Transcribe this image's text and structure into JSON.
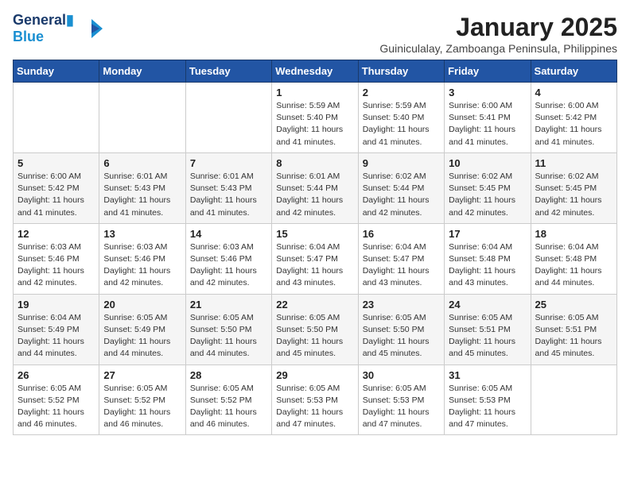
{
  "logo": {
    "line1": "General",
    "line2": "Blue"
  },
  "title": "January 2025",
  "subtitle": "Guiniculalay, Zamboanga Peninsula, Philippines",
  "days_of_week": [
    "Sunday",
    "Monday",
    "Tuesday",
    "Wednesday",
    "Thursday",
    "Friday",
    "Saturday"
  ],
  "weeks": [
    [
      {
        "day": "",
        "info": ""
      },
      {
        "day": "",
        "info": ""
      },
      {
        "day": "",
        "info": ""
      },
      {
        "day": "1",
        "info": "Sunrise: 5:59 AM\nSunset: 5:40 PM\nDaylight: 11 hours\nand 41 minutes."
      },
      {
        "day": "2",
        "info": "Sunrise: 5:59 AM\nSunset: 5:40 PM\nDaylight: 11 hours\nand 41 minutes."
      },
      {
        "day": "3",
        "info": "Sunrise: 6:00 AM\nSunset: 5:41 PM\nDaylight: 11 hours\nand 41 minutes."
      },
      {
        "day": "4",
        "info": "Sunrise: 6:00 AM\nSunset: 5:42 PM\nDaylight: 11 hours\nand 41 minutes."
      }
    ],
    [
      {
        "day": "5",
        "info": "Sunrise: 6:00 AM\nSunset: 5:42 PM\nDaylight: 11 hours\nand 41 minutes."
      },
      {
        "day": "6",
        "info": "Sunrise: 6:01 AM\nSunset: 5:43 PM\nDaylight: 11 hours\nand 41 minutes."
      },
      {
        "day": "7",
        "info": "Sunrise: 6:01 AM\nSunset: 5:43 PM\nDaylight: 11 hours\nand 41 minutes."
      },
      {
        "day": "8",
        "info": "Sunrise: 6:01 AM\nSunset: 5:44 PM\nDaylight: 11 hours\nand 42 minutes."
      },
      {
        "day": "9",
        "info": "Sunrise: 6:02 AM\nSunset: 5:44 PM\nDaylight: 11 hours\nand 42 minutes."
      },
      {
        "day": "10",
        "info": "Sunrise: 6:02 AM\nSunset: 5:45 PM\nDaylight: 11 hours\nand 42 minutes."
      },
      {
        "day": "11",
        "info": "Sunrise: 6:02 AM\nSunset: 5:45 PM\nDaylight: 11 hours\nand 42 minutes."
      }
    ],
    [
      {
        "day": "12",
        "info": "Sunrise: 6:03 AM\nSunset: 5:46 PM\nDaylight: 11 hours\nand 42 minutes."
      },
      {
        "day": "13",
        "info": "Sunrise: 6:03 AM\nSunset: 5:46 PM\nDaylight: 11 hours\nand 42 minutes."
      },
      {
        "day": "14",
        "info": "Sunrise: 6:03 AM\nSunset: 5:46 PM\nDaylight: 11 hours\nand 42 minutes."
      },
      {
        "day": "15",
        "info": "Sunrise: 6:04 AM\nSunset: 5:47 PM\nDaylight: 11 hours\nand 43 minutes."
      },
      {
        "day": "16",
        "info": "Sunrise: 6:04 AM\nSunset: 5:47 PM\nDaylight: 11 hours\nand 43 minutes."
      },
      {
        "day": "17",
        "info": "Sunrise: 6:04 AM\nSunset: 5:48 PM\nDaylight: 11 hours\nand 43 minutes."
      },
      {
        "day": "18",
        "info": "Sunrise: 6:04 AM\nSunset: 5:48 PM\nDaylight: 11 hours\nand 44 minutes."
      }
    ],
    [
      {
        "day": "19",
        "info": "Sunrise: 6:04 AM\nSunset: 5:49 PM\nDaylight: 11 hours\nand 44 minutes."
      },
      {
        "day": "20",
        "info": "Sunrise: 6:05 AM\nSunset: 5:49 PM\nDaylight: 11 hours\nand 44 minutes."
      },
      {
        "day": "21",
        "info": "Sunrise: 6:05 AM\nSunset: 5:50 PM\nDaylight: 11 hours\nand 44 minutes."
      },
      {
        "day": "22",
        "info": "Sunrise: 6:05 AM\nSunset: 5:50 PM\nDaylight: 11 hours\nand 45 minutes."
      },
      {
        "day": "23",
        "info": "Sunrise: 6:05 AM\nSunset: 5:50 PM\nDaylight: 11 hours\nand 45 minutes."
      },
      {
        "day": "24",
        "info": "Sunrise: 6:05 AM\nSunset: 5:51 PM\nDaylight: 11 hours\nand 45 minutes."
      },
      {
        "day": "25",
        "info": "Sunrise: 6:05 AM\nSunset: 5:51 PM\nDaylight: 11 hours\nand 45 minutes."
      }
    ],
    [
      {
        "day": "26",
        "info": "Sunrise: 6:05 AM\nSunset: 5:52 PM\nDaylight: 11 hours\nand 46 minutes."
      },
      {
        "day": "27",
        "info": "Sunrise: 6:05 AM\nSunset: 5:52 PM\nDaylight: 11 hours\nand 46 minutes."
      },
      {
        "day": "28",
        "info": "Sunrise: 6:05 AM\nSunset: 5:52 PM\nDaylight: 11 hours\nand 46 minutes."
      },
      {
        "day": "29",
        "info": "Sunrise: 6:05 AM\nSunset: 5:53 PM\nDaylight: 11 hours\nand 47 minutes."
      },
      {
        "day": "30",
        "info": "Sunrise: 6:05 AM\nSunset: 5:53 PM\nDaylight: 11 hours\nand 47 minutes."
      },
      {
        "day": "31",
        "info": "Sunrise: 6:05 AM\nSunset: 5:53 PM\nDaylight: 11 hours\nand 47 minutes."
      },
      {
        "day": "",
        "info": ""
      }
    ]
  ]
}
